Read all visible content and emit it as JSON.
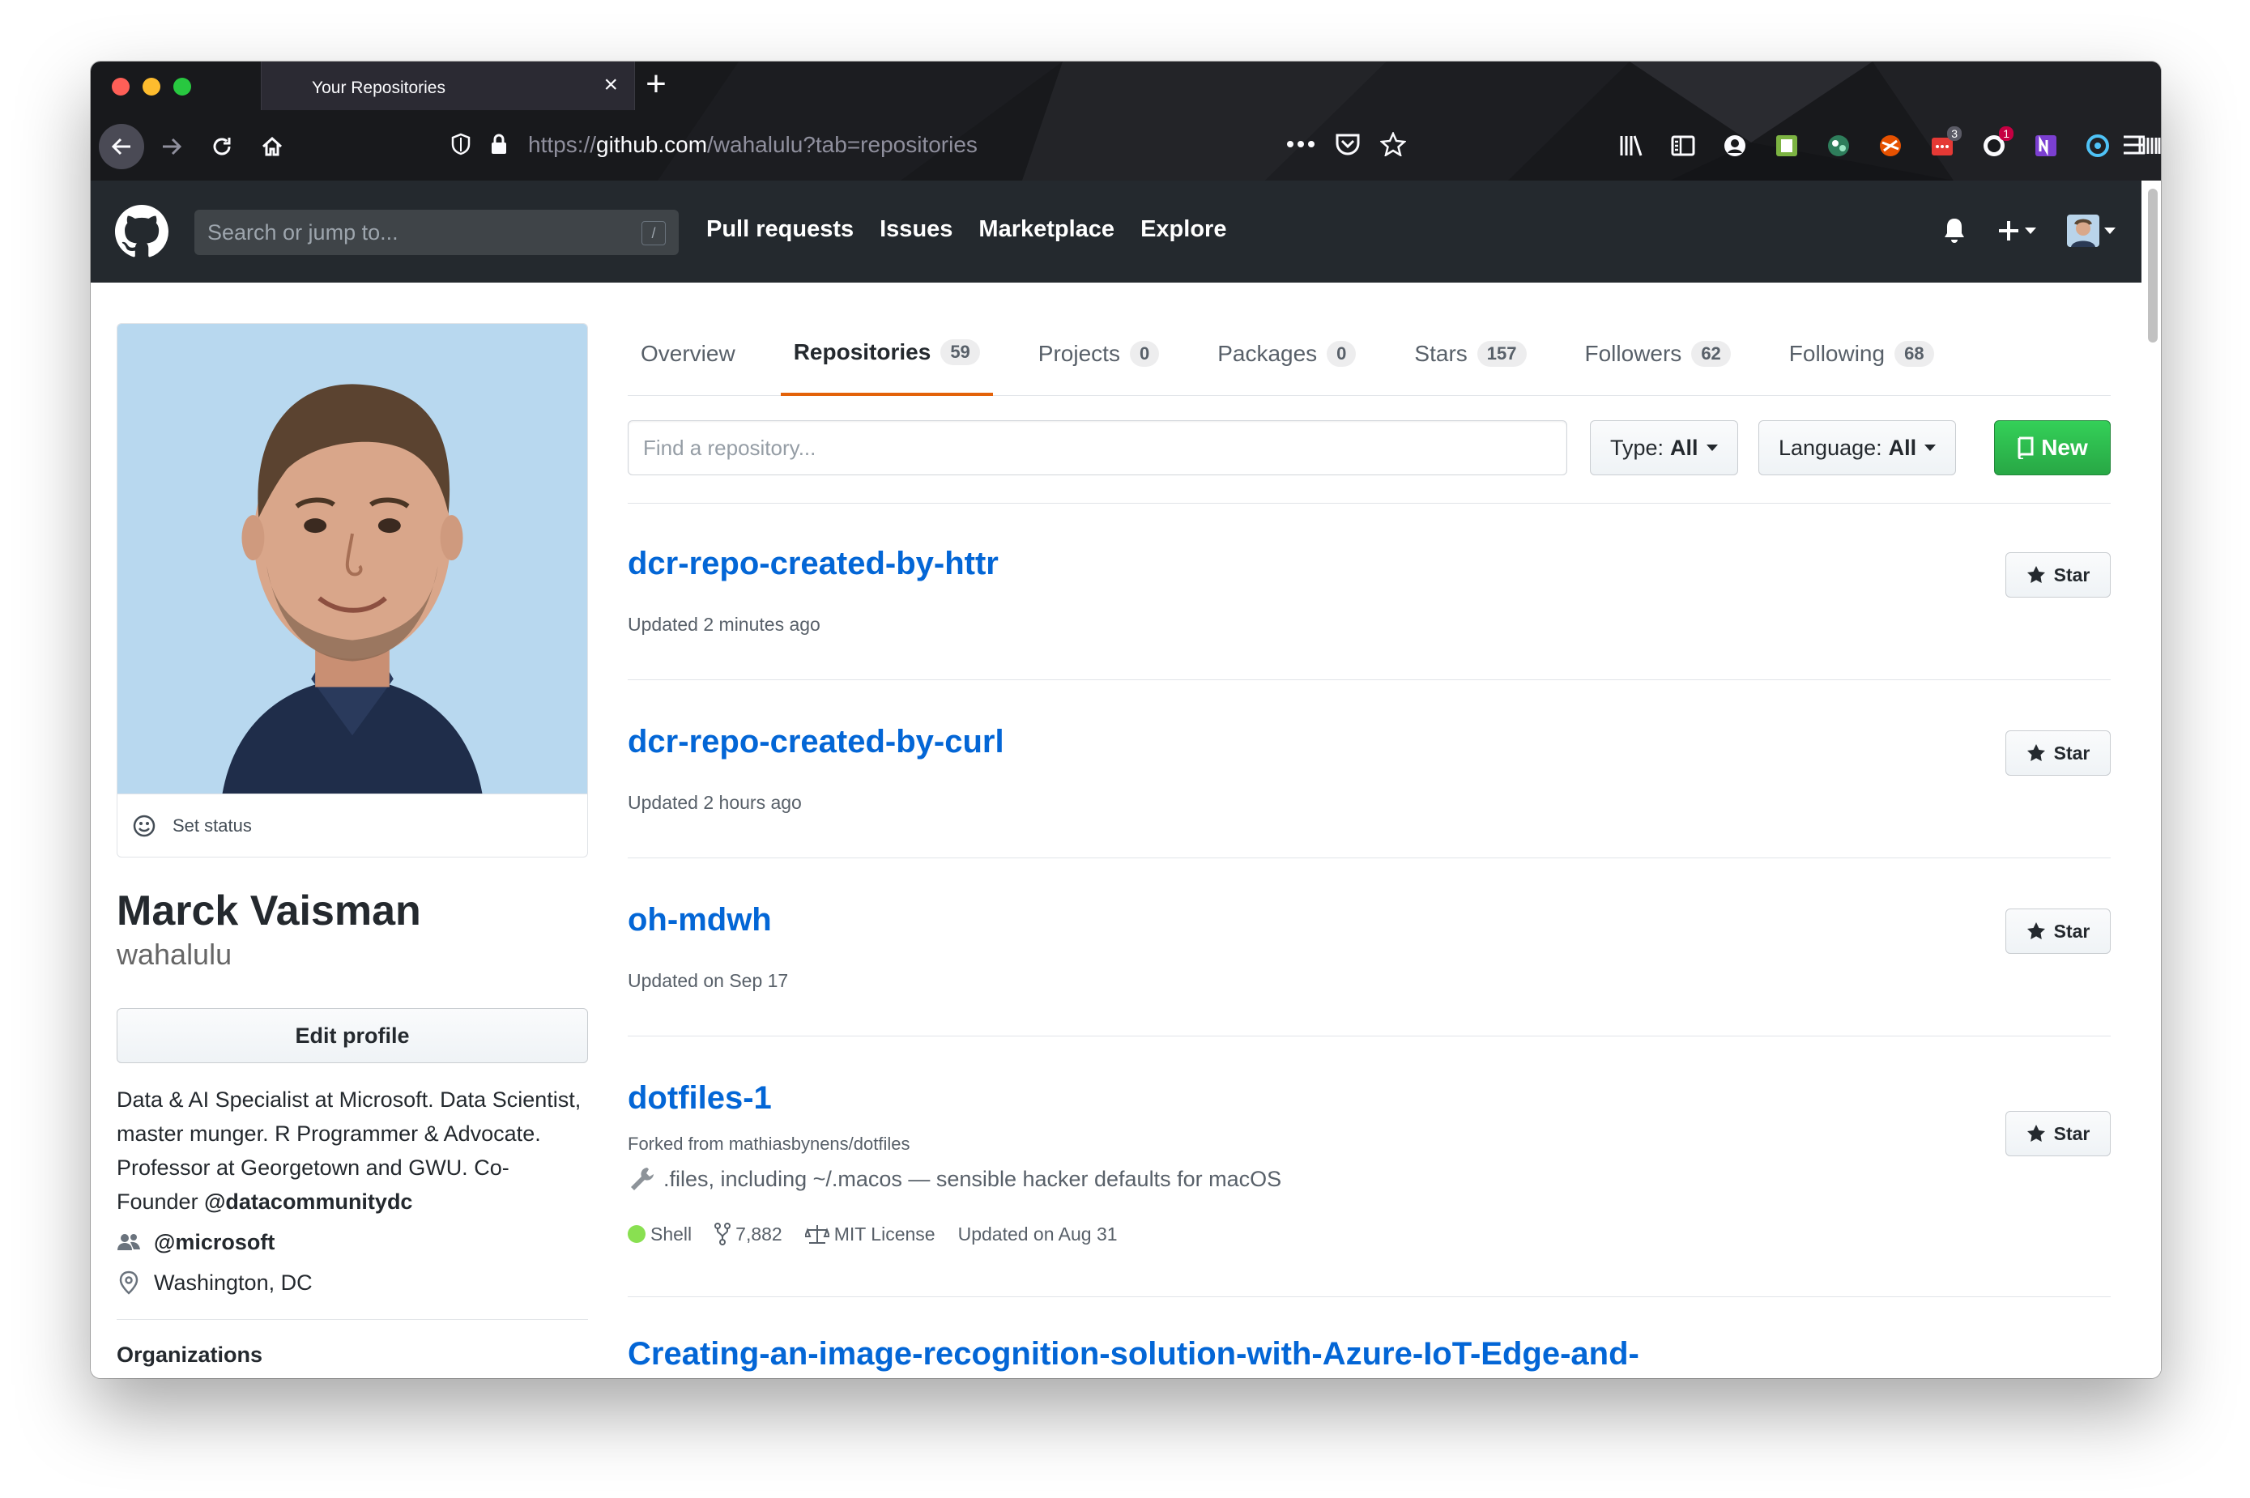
{
  "browser": {
    "tab_title": "Your Repositories",
    "url_prefix": "https://",
    "url_domain": "github.com",
    "url_path": "/wahalulu?tab=repositories",
    "badges": {
      "extension_red": "3",
      "extension_notif": "1"
    }
  },
  "header": {
    "search_placeholder": "Search or jump to...",
    "search_shortcut": "/",
    "nav": [
      "Pull requests",
      "Issues",
      "Marketplace",
      "Explore"
    ]
  },
  "profile": {
    "set_status": "Set status",
    "full_name": "Marck Vaisman",
    "username": "wahalulu",
    "edit_profile": "Edit profile",
    "bio_text": "Data & AI Specialist at Microsoft. Data Scientist, master munger. R Programmer & Advocate. Professor at Georgetown and GWU. Co-Founder ",
    "bio_mention": "@datacommunitydc",
    "company": "@microsoft",
    "location": "Washington, DC",
    "organizations_heading": "Organizations"
  },
  "tabs": [
    {
      "label": "Overview",
      "count": null
    },
    {
      "label": "Repositories",
      "count": "59"
    },
    {
      "label": "Projects",
      "count": "0"
    },
    {
      "label": "Packages",
      "count": "0"
    },
    {
      "label": "Stars",
      "count": "157"
    },
    {
      "label": "Followers",
      "count": "62"
    },
    {
      "label": "Following",
      "count": "68"
    }
  ],
  "filters": {
    "find_placeholder": "Find a repository...",
    "type_label": "Type:",
    "type_value": "All",
    "language_label": "Language:",
    "language_value": "All",
    "new_label": "New"
  },
  "repos": [
    {
      "name": "dcr-repo-created-by-httr",
      "updated": "Updated 2 minutes ago",
      "star": "Star"
    },
    {
      "name": "dcr-repo-created-by-curl",
      "updated": "Updated 2 hours ago",
      "star": "Star"
    },
    {
      "name": "oh-mdwh",
      "updated": "Updated on Sep 17",
      "star": "Star"
    },
    {
      "name": "dotfiles-1",
      "forked_from": "Forked from mathiasbynens/dotfiles",
      "description": ".files, including ~/.macos — sensible hacker defaults for macOS",
      "language": "Shell",
      "language_color": "#89e051",
      "forks": "7,882",
      "license": "MIT License",
      "updated": "Updated on Aug 31",
      "star": "Star"
    },
    {
      "name": "Creating-an-image-recognition-solution-with-Azure-IoT-Edge-and-"
    }
  ],
  "colors": {
    "link": "#0366d6",
    "active_tab_underline": "#e36209",
    "new_button": "#28a745",
    "header_bg": "#24292e"
  }
}
